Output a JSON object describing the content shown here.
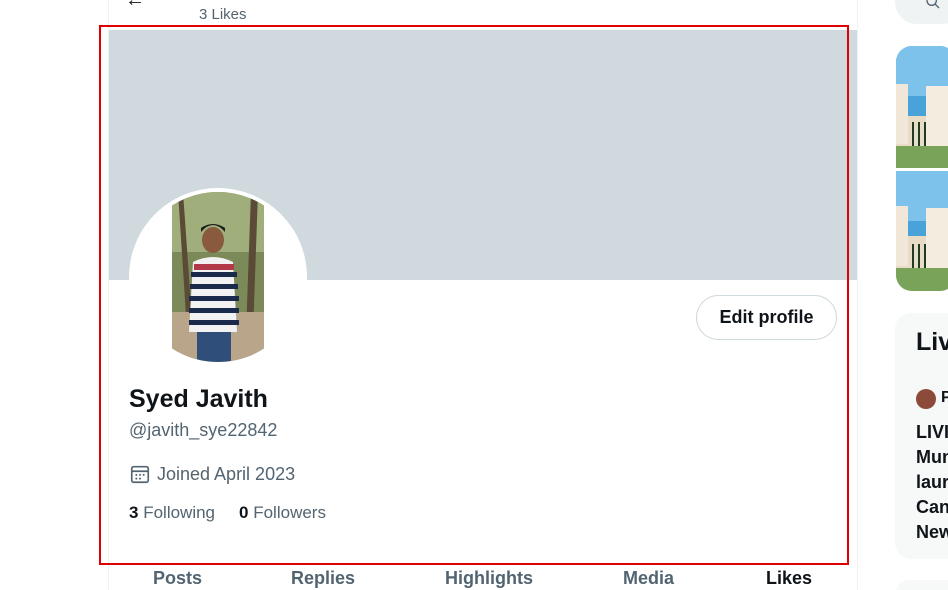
{
  "header": {
    "likes_count": "3 Likes"
  },
  "profile": {
    "display_name": "Syed Javith",
    "handle": "@javith_sye22842",
    "joined": "Joined April 2023",
    "following_count": "3",
    "following_label": "Following",
    "followers_count": "0",
    "followers_label": "Followers",
    "edit_button_label": "Edit profile"
  },
  "tabs": [
    "Posts",
    "Replies",
    "Highlights",
    "Media",
    "Likes"
  ],
  "active_tab": "Likes",
  "sidebar": {
    "live_title": "Liv",
    "live_user": "P",
    "live_text_lines": [
      "LIVI",
      "Mun",
      "laur",
      "Can",
      "New"
    ]
  },
  "colors": {
    "banner": "#cfd9de",
    "secondary_text": "#536471",
    "primary_text": "#0f1419",
    "highlight_border": "#e00000"
  }
}
